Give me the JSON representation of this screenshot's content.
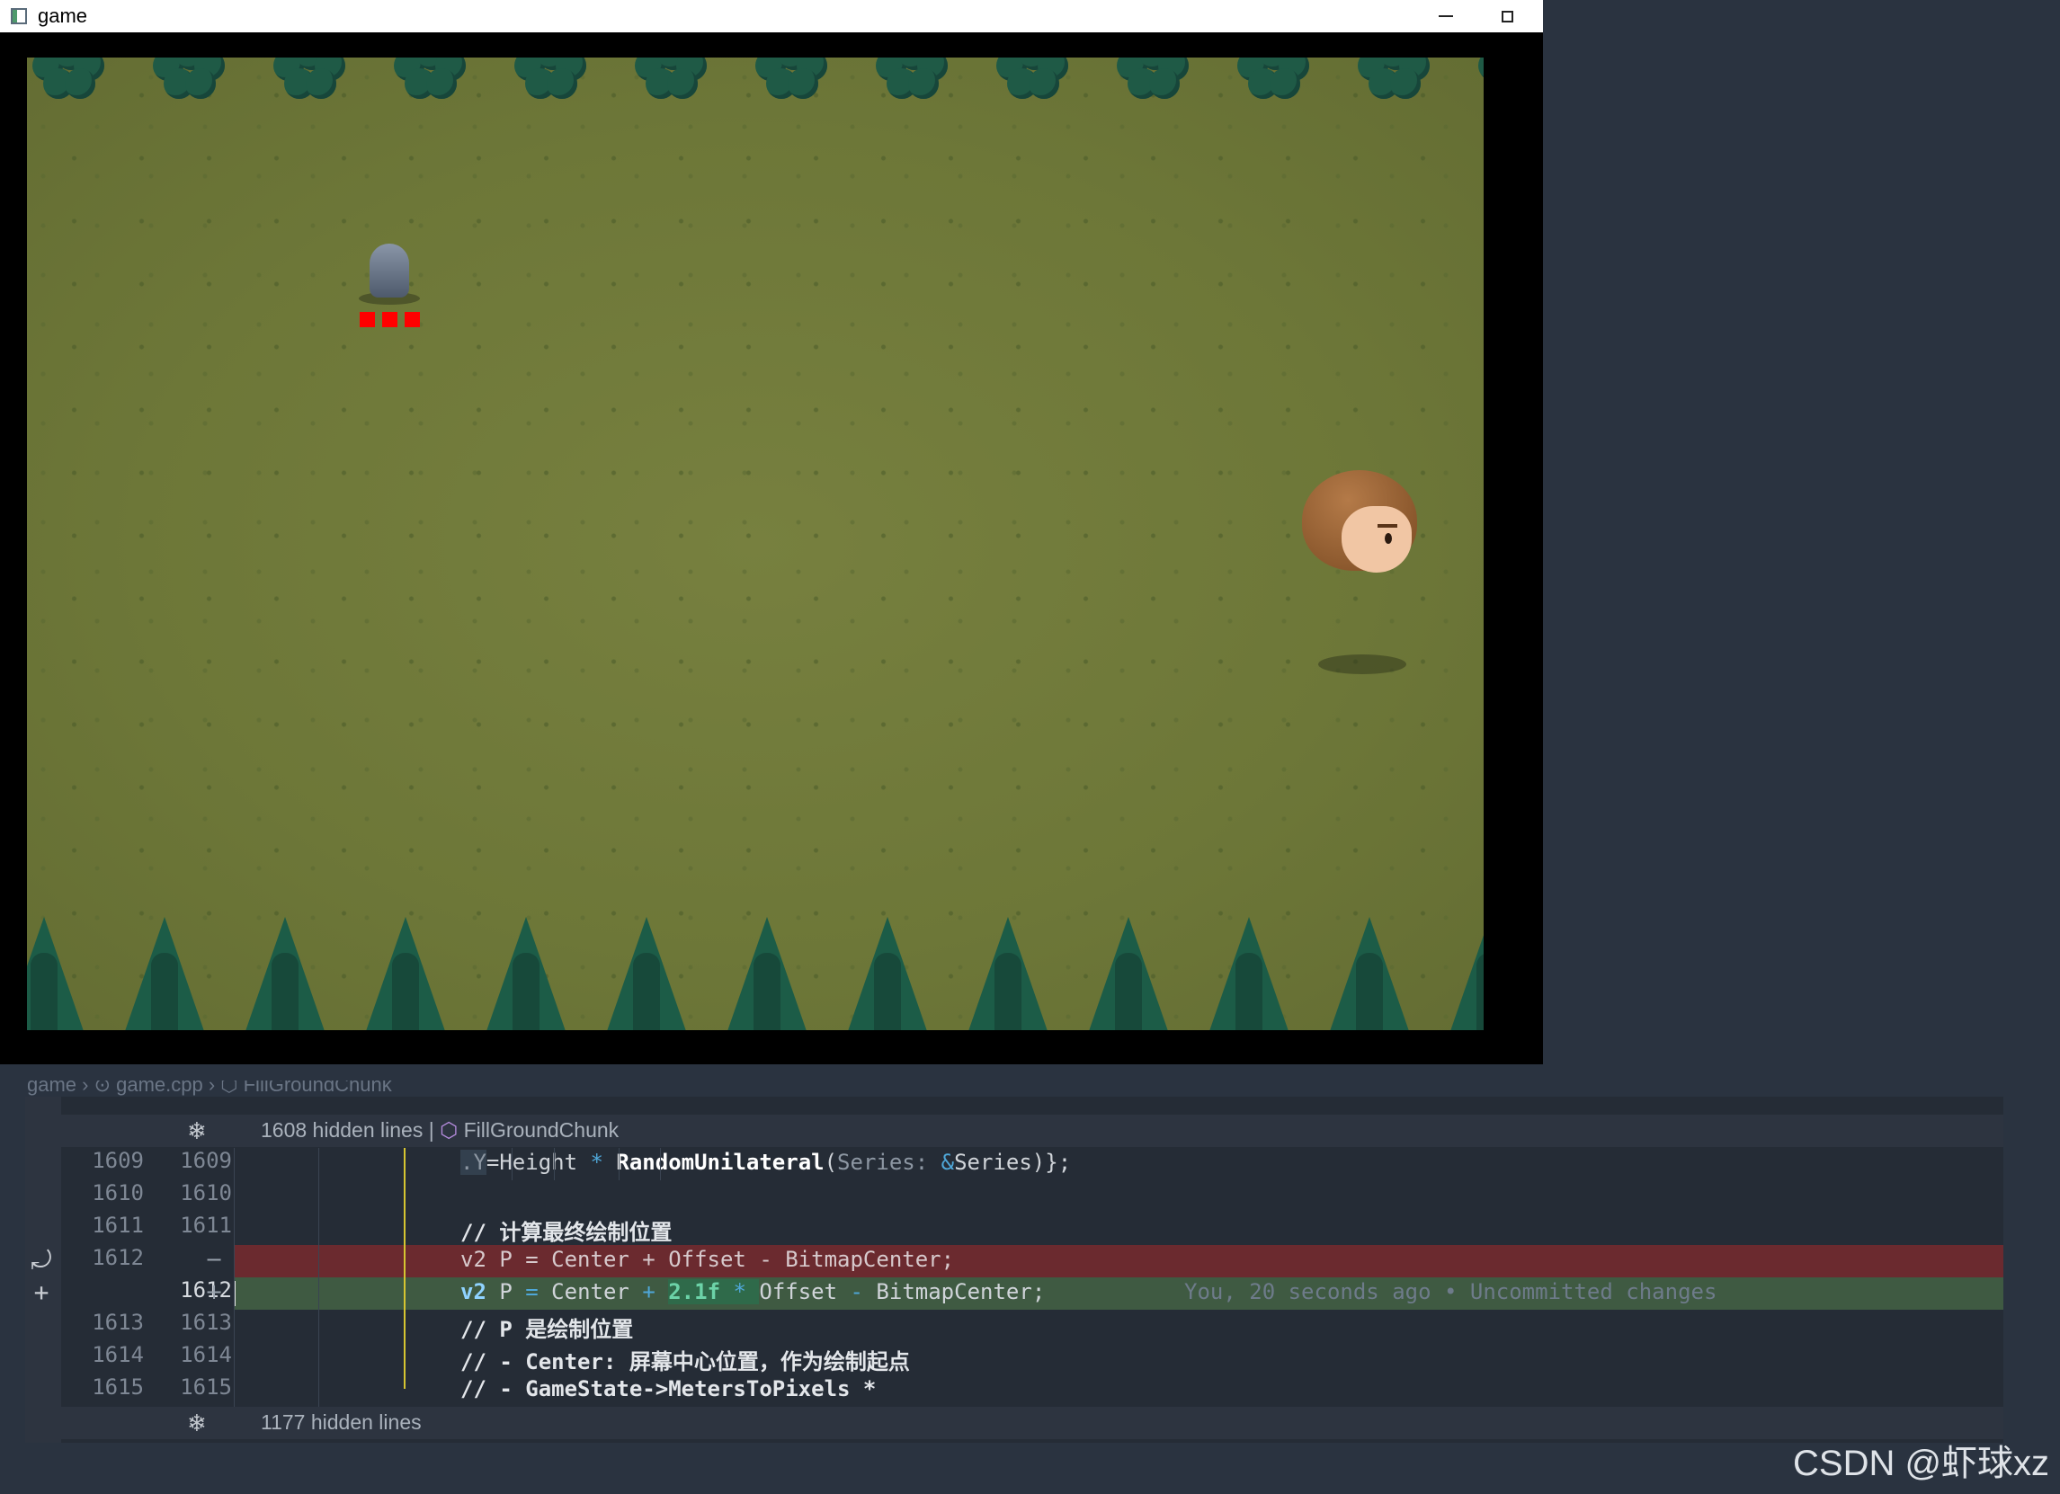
{
  "window": {
    "title": "game"
  },
  "breadcrumb": "game › ⊙ game.cpp › ⬡ FillGroundChunk",
  "diff": {
    "hidden_top": {
      "text": "1608 hidden lines",
      "separator": "|",
      "symbol": "FillGroundChunk"
    },
    "hidden_bottom": {
      "text": "1177 hidden lines"
    },
    "lines": [
      {
        "old": "1609",
        "new": "1609",
        "code": ".Y=Height * RandomUnilateral(Series: &Series)};"
      },
      {
        "old": "1610",
        "new": "1610",
        "code": ""
      },
      {
        "old": "1611",
        "new": "1611",
        "code": "// 计算最终绘制位置"
      },
      {
        "old": "1612",
        "new": "",
        "marker": "−",
        "code": "v2 P = Center + Offset - BitmapCenter;",
        "status": "removed"
      },
      {
        "old": "",
        "new": "1612",
        "marker": "+",
        "code": "v2 P = Center + 2.1f * Offset - BitmapCenter;",
        "status": "added",
        "blame": "You, 20 seconds ago • Uncommitted changes"
      },
      {
        "old": "1613",
        "new": "1613",
        "code": "// P 是绘制位置"
      },
      {
        "old": "1614",
        "new": "1614",
        "code": "// - Center: 屏幕中心位置，作为绘制起点"
      },
      {
        "old": "1615",
        "new": "1615",
        "code": "// - GameState->MetersToPixels *"
      }
    ]
  },
  "watermark": "CSDN @虾球xz",
  "colors": {
    "removed_bg": "#6b2a2f",
    "added_bg": "#3f5a42",
    "editor_bg": "#252c36",
    "grass": "#6d7738"
  }
}
